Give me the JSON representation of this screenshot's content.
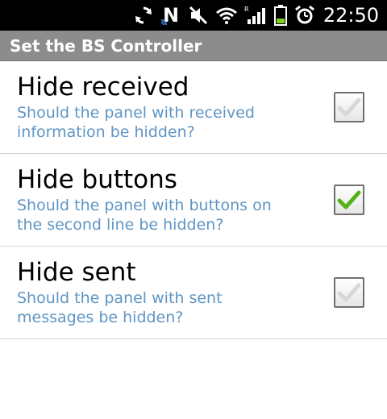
{
  "status_bar": {
    "time": "22:50",
    "icons": [
      "sync-icon",
      "nfc-icon",
      "mute-icon",
      "wifi-icon",
      "signal-icon",
      "battery-icon",
      "alarm-icon"
    ]
  },
  "header": {
    "title": "Set the BS Controller"
  },
  "preferences": [
    {
      "title": "Hide received",
      "summary": "Should the panel with received information be hidden?",
      "checked": false
    },
    {
      "title": "Hide buttons",
      "summary": "Should the panel with buttons on the second line be hidden?",
      "checked": true
    },
    {
      "title": "Hide sent",
      "summary": "Should the panel with sent messages be hidden?",
      "checked": false
    }
  ],
  "colors": {
    "summary_text": "#5f95c4",
    "check_on": "#55b319",
    "check_off": "#d8d8d8",
    "battery": "#7ed321"
  }
}
